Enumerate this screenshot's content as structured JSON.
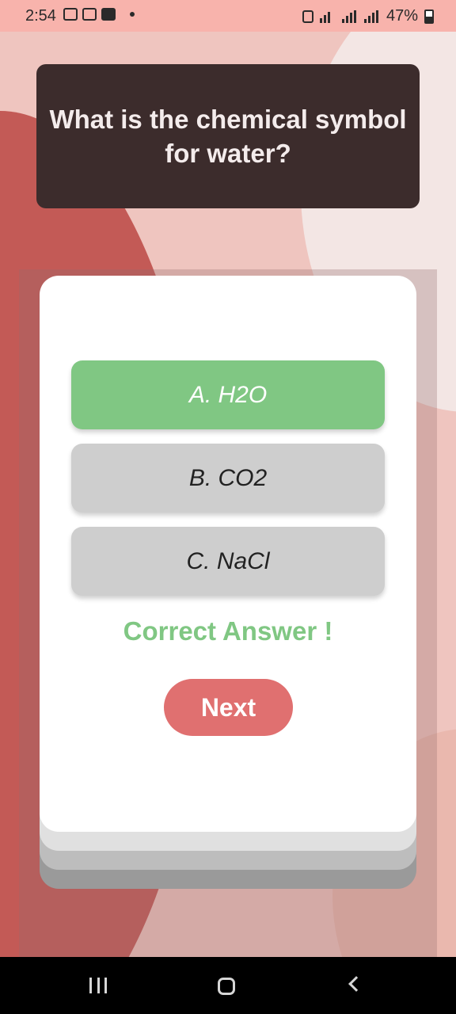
{
  "status_bar": {
    "time": "2:54",
    "battery": "47%",
    "left_icons": [
      "image-icon",
      "chat-icon",
      "folder-icon",
      "notification-dot-icon"
    ],
    "right_icons": [
      "lock-icon",
      "wifi-icon",
      "signal-icon",
      "call-signal-icon",
      "battery-icon"
    ]
  },
  "quiz": {
    "question": "What is the chemical symbol for water?",
    "options": [
      {
        "label": "A. H2O",
        "state": "correct"
      },
      {
        "label": "B. CO2",
        "state": "neutral"
      },
      {
        "label": "C. NaCl",
        "state": "neutral"
      }
    ],
    "feedback": "Correct Answer !",
    "next_label": "Next"
  },
  "colors": {
    "correct": "#80c783",
    "neutral_option": "#cecece",
    "next_button": "#e07070",
    "question_bg": "#3c2c2c"
  },
  "nav_bar": {
    "icons": [
      "recents-icon",
      "home-icon",
      "back-icon"
    ]
  }
}
